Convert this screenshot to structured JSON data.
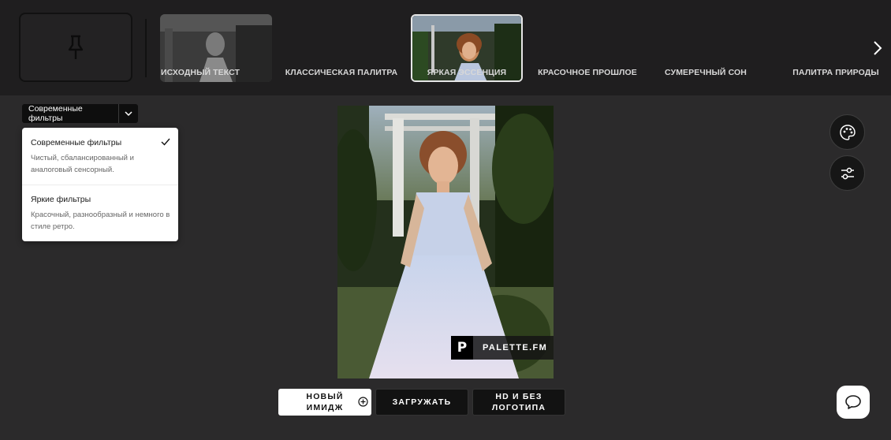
{
  "presets": [
    {
      "label": "ИСХОДНЫЙ ТЕКСТ",
      "active": false
    },
    {
      "label": "КЛАССИЧЕСКАЯ ПАЛИТРА",
      "active": false
    },
    {
      "label": "ЯРКАЯ ЭССЕНЦИЯ",
      "active": true
    },
    {
      "label": "КРАСОЧНОЕ ПРОШЛОЕ",
      "active": false
    },
    {
      "label": "СУМЕРЕЧНЫЙ СОН",
      "active": false
    },
    {
      "label": "ПАЛИТРА ПРИРОДЫ",
      "active": false
    }
  ],
  "filter_select": {
    "value": "Современные фильтры"
  },
  "dropdown": {
    "items": [
      {
        "title": "Современные фильтры",
        "description": "Чистый, сбалансированный и аналоговый сенсорный.",
        "selected": true
      },
      {
        "title": "Яркие фильтры",
        "description": "Красочный, разнообразный и немного в стиле ретро.",
        "selected": false
      }
    ]
  },
  "watermark": {
    "text": "PALETTE.FM",
    "logo_letter": "P"
  },
  "actions": {
    "new_image": "НОВЫЙ ИМИДЖ",
    "upload": "ЗАГРУЖАТЬ",
    "hd": "HD И БЕЗ ЛОГОТИПА"
  },
  "icons": {
    "pin": "pin-icon",
    "next": "chevron-right-icon",
    "palette": "palette-icon",
    "sliders": "sliders-icon",
    "chat": "chat-icon",
    "plus": "plus-circle-icon",
    "check": "check-icon",
    "chevron": "chevron-down-icon"
  },
  "colors": {
    "background": "#2b2a2b",
    "topbar": "#1f1e1f",
    "button_light": "#ffffff",
    "button_dark": "#121212"
  }
}
